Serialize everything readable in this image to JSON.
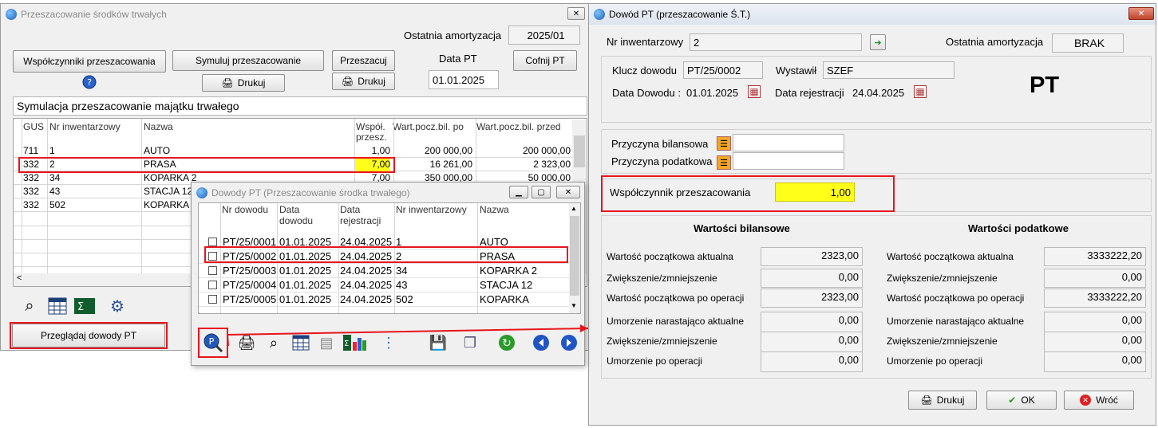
{
  "w1": {
    "title": "Przeszacowanie środków trwałych",
    "last_amort_label": "Ostatnia amortyzacja",
    "last_amort_value": "2025/01",
    "btn_coef": "Współczynniki  przeszacowania",
    "btn_simulate": "Symuluj przeszacowanie",
    "btn_print": "Drukuj",
    "btn_revalue": "Przeszacuj",
    "btn_print2": "Drukuj",
    "date_label": "Data PT",
    "date_value": "01.01.2025",
    "btn_undo": "Cofnij  PT",
    "sim_title": "Symulacja przeszacowanie majątku trwałego",
    "headers": [
      "GUS",
      "Nr inwentarzowy",
      "Nazwa",
      "Współ.",
      "przesz.",
      "Wart.pocz.bil. po",
      "Wart.pocz.bil. przed"
    ],
    "rows": [
      {
        "gus": "711",
        "nr": "1",
        "name": "AUTO",
        "coef": "1,00",
        "after": "200 000,00",
        "before": "200 000,00"
      },
      {
        "gus": "332",
        "nr": "2",
        "name": "PRASA",
        "coef": "7,00",
        "after": "16 261,00",
        "before": "2 323,00"
      },
      {
        "gus": "332",
        "nr": "34",
        "name": "KOPARKA 2",
        "coef": "7,00",
        "after": "350 000,00",
        "before": "50 000,00"
      },
      {
        "gus": "332",
        "nr": "43",
        "name": "STACJA 12",
        "coef": "",
        "after": "",
        "before": ""
      },
      {
        "gus": "332",
        "nr": "502",
        "name": "KOPARKA",
        "coef": "",
        "after": "",
        "before": ""
      }
    ],
    "btn_browse": "Przeglądaj dowody PT"
  },
  "w2": {
    "title": "Dowody PT (Przeszacowanie środka trwałego)",
    "headers": [
      "Nr dowodu",
      "Data",
      "dowodu",
      "Data",
      "rejestracji",
      "Nr inwentarzowy",
      "Nazwa"
    ],
    "rows": [
      {
        "nr": "PT/25/0001",
        "d1": "01.01.2025",
        "d2": "24.04.2025",
        "inv": "1",
        "name": "AUTO"
      },
      {
        "nr": "PT/25/0002",
        "d1": "01.01.2025",
        "d2": "24.04.2025",
        "inv": "2",
        "name": "PRASA"
      },
      {
        "nr": "PT/25/0003",
        "d1": "01.01.2025",
        "d2": "24.04.2025",
        "inv": "34",
        "name": "KOPARKA 2"
      },
      {
        "nr": "PT/25/0004",
        "d1": "01.01.2025",
        "d2": "24.04.2025",
        "inv": "43",
        "name": "STACJA 12"
      },
      {
        "nr": "PT/25/0005",
        "d1": "01.01.2025",
        "d2": "24.04.2025",
        "inv": "502",
        "name": "KOPARKA"
      }
    ]
  },
  "w3": {
    "title": "Dowód PT (przeszacowanie Ś.T.)",
    "nr_inv_label": "Nr inwentarzowy",
    "nr_inv_value": "2",
    "last_amort_label": "Ostatnia amortyzacja",
    "last_amort_value": "BRAK",
    "key_label": "Klucz dowodu",
    "key_value": "PT/25/0002",
    "issued_label": "Wystawił",
    "issued_value": "SZEF",
    "date_doc_label": "Data Dowodu :",
    "date_doc_value": "01.01.2025",
    "date_reg_label": "Data rejestracji",
    "date_reg_value": "24.04.2025",
    "big": "PT",
    "reason_bil": "Przyczyna bilansowa",
    "reason_tax": "Przyczyna podatkowa",
    "coef_label": "Współczynnik przeszacowania",
    "coef_value": "1,00",
    "bil_title": "Wartości bilansowe",
    "tax_title": "Wartości podatkowe",
    "bil": [
      {
        "l": "Wartość początkowa aktualna",
        "v": "2323,00"
      },
      {
        "l": "Zwiększenie/zmniejszenie",
        "v": "0,00"
      },
      {
        "l": "Wartość początkowa po operacji",
        "v": "2323,00"
      },
      {
        "l": "Umorzenie narastająco aktualne",
        "v": "0,00"
      },
      {
        "l": "Zwiększenie/zmniejszenie",
        "v": "0,00"
      },
      {
        "l": "Umorzenie po operacji",
        "v": "0,00"
      }
    ],
    "tax": [
      {
        "l": "Wartość początkowa aktualna",
        "v": "3333222,20"
      },
      {
        "l": "Zwiększenie/zmniejszenie",
        "v": "0,00"
      },
      {
        "l": "Wartość początkowa po operacji",
        "v": "3333222,20"
      },
      {
        "l": "Umorzenie narastająco aktualne",
        "v": "0,00"
      },
      {
        "l": "Zwiększenie/zmniejszenie",
        "v": "0,00"
      },
      {
        "l": "Umorzenie po operacji",
        "v": "0,00"
      }
    ],
    "btn_print": "Drukuj",
    "btn_ok": "OK",
    "btn_back": "Wróć"
  },
  "colors": {
    "red": "#e8141c",
    "yellow": "#ffff1a"
  }
}
